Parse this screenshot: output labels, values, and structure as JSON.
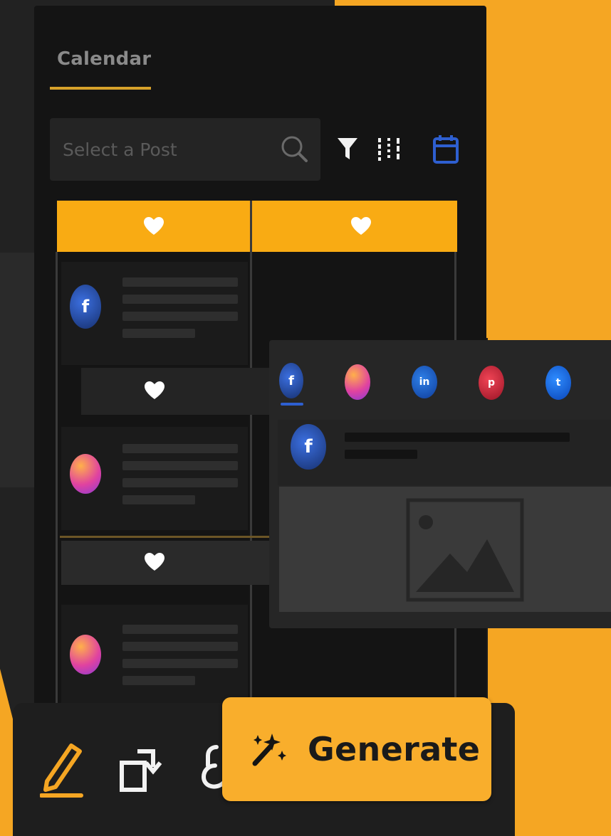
{
  "app": {
    "tabs": [
      {
        "label": "Calendar",
        "active": true
      }
    ]
  },
  "search": {
    "placeholder": "Select a Post"
  },
  "toolbar_icons": [
    "search-icon",
    "filter-icon",
    "sliders-icon",
    "calendar-icon"
  ],
  "calendar": {
    "columns": [
      {
        "header_icon": "heart-icon"
      },
      {
        "header_icon": "heart-icon"
      }
    ],
    "posts": [
      {
        "network": "facebook",
        "letter": "f"
      },
      {
        "network": "instagram",
        "letter": ""
      },
      {
        "network": "instagram",
        "letter": ""
      }
    ]
  },
  "preview": {
    "networks": [
      {
        "name": "facebook",
        "letter": "f",
        "active": true
      },
      {
        "name": "instagram",
        "letter": "",
        "active": false
      },
      {
        "name": "linkedin",
        "letter": "in",
        "active": false
      },
      {
        "name": "pinterest",
        "letter": "p",
        "active": false
      },
      {
        "name": "twitter",
        "letter": "t",
        "active": false
      }
    ],
    "author_avatar": {
      "network": "facebook",
      "letter": "f"
    },
    "image_icon": "image-placeholder-icon"
  },
  "bottom_toolbar": {
    "tools": [
      "pencil-icon",
      "resize-icon",
      "lock-icon"
    ],
    "generate_label": "Generate",
    "generate_icon": "magic-wand-icon"
  },
  "colors": {
    "accent": "#f9ab13",
    "background": "#141414",
    "panel": "#262626",
    "calendar_icon": "#2e5fd0"
  }
}
